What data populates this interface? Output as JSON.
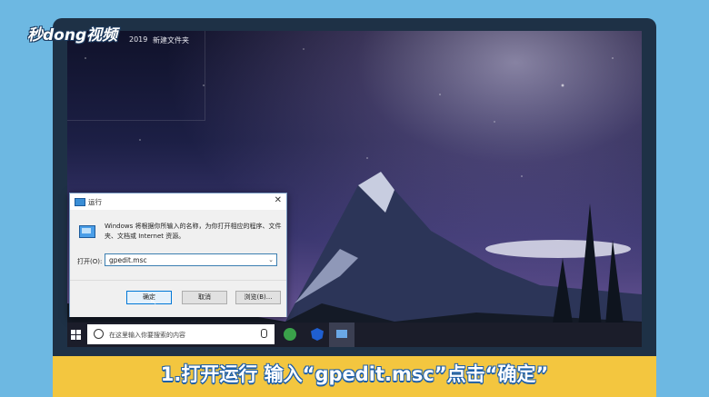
{
  "watermark": {
    "logo_text": "秒dong视频"
  },
  "desktop": {
    "label_year": "2019",
    "label_folder": "新建文件夹"
  },
  "run_dialog": {
    "title": "运行",
    "close_glyph": "✕",
    "description": "Windows 将根据你所输入的名称，为你打开相应的程序、文件夹、文档或 Internet 资源。",
    "open_label": "打开(O):",
    "open_value": "gpedit.msc",
    "buttons": {
      "ok": "确定",
      "cancel": "取消",
      "browse": "浏览(B)..."
    }
  },
  "taskbar": {
    "search_placeholder": "在这里输入你要搜索的内容"
  },
  "subtitle": "1.打开运行 输入“gpedit.msc”点击“确定”",
  "colors": {
    "accent_yellow": "#f3c63f",
    "frame_blue": "#6db8e2",
    "taskbar": "#1b1d2a"
  }
}
